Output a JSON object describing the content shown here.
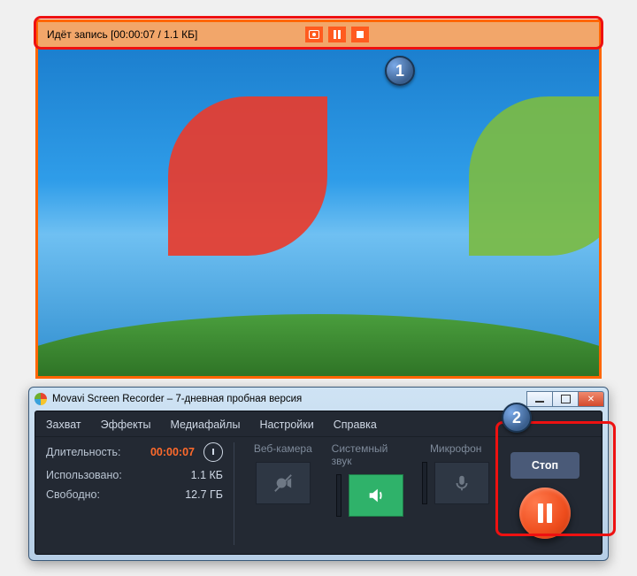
{
  "capture": {
    "status": "Идёт запись [00:00:07 / 1.1 КБ]"
  },
  "callouts": {
    "n1": "1",
    "n2": "2"
  },
  "window": {
    "title": "Movavi Screen Recorder – 7-дневная пробная версия"
  },
  "menu": {
    "items": [
      "Захват",
      "Эффекты",
      "Медиафайлы",
      "Настройки",
      "Справка"
    ]
  },
  "stats": {
    "duration_label": "Длительность:",
    "duration_value": "00:00:07",
    "used_label": "Использовано:",
    "used_value": "1.1 КБ",
    "free_label": "Свободно:",
    "free_value": "12.7 ГБ"
  },
  "devices": {
    "webcam_label": "Веб-камера",
    "system_audio_label": "Системный звук",
    "mic_label": "Микрофон"
  },
  "controls": {
    "stop_label": "Стоп"
  }
}
